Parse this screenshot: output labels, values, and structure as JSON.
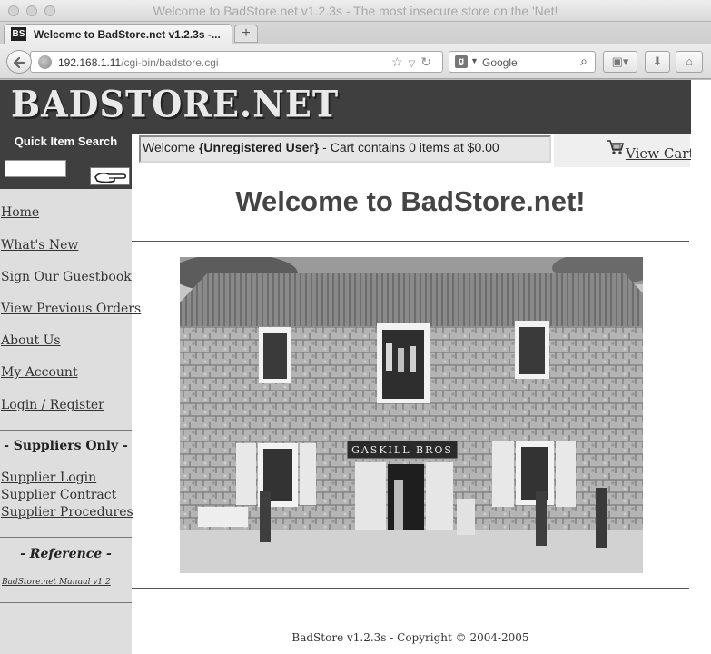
{
  "window": {
    "title": "Welcome to BadStore.net v1.2.3s - The most insecure store on the 'Net!"
  },
  "tab": {
    "favicon_text": "BS",
    "label": "Welcome to BadStore.net v1.2.3s -...",
    "new_tab_symbol": "+"
  },
  "navbar": {
    "url_host": "192.168.1.11",
    "url_path": "/cgi-bin/badstore.cgi",
    "search_engine_badge": "g",
    "search_placeholder": "Google"
  },
  "site": {
    "logo": "BADSTORE.NET",
    "quick_search_title": "Quick Item Search",
    "quick_search_value": ""
  },
  "sidebar": {
    "nav": [
      {
        "label": "Home"
      },
      {
        "label": "What's New"
      },
      {
        "label": "Sign Our Guestbook"
      },
      {
        "label": "View Previous Orders"
      },
      {
        "label": "About Us"
      },
      {
        "label": "My Account"
      },
      {
        "label": "Login / Register"
      }
    ],
    "suppliers_heading": "- Suppliers Only -",
    "suppliers": [
      {
        "label": "Supplier Login"
      },
      {
        "label": "Supplier Contract"
      },
      {
        "label": "Supplier Procedures"
      }
    ],
    "reference_heading": "- Reference -",
    "manual_link": "BadStore.net Manual v1.2"
  },
  "welcome": {
    "prefix": "Welcome ",
    "user": "{Unregistered User}",
    "cart_text": " - Cart contains 0 items at $0.00",
    "view_cart": "View Cart"
  },
  "main": {
    "title": "Welcome to BadStore.net!",
    "photo_sign": "GASKILL BROS"
  },
  "footer": {
    "text": "BadStore v1.2.3s - Copyright © 2004-2005"
  },
  "icons": {
    "back": "back-arrow-icon",
    "reload": "reload-icon",
    "bookmark": "star-icon",
    "search": "magnifier-icon",
    "cart": "shopping-cart-icon"
  }
}
